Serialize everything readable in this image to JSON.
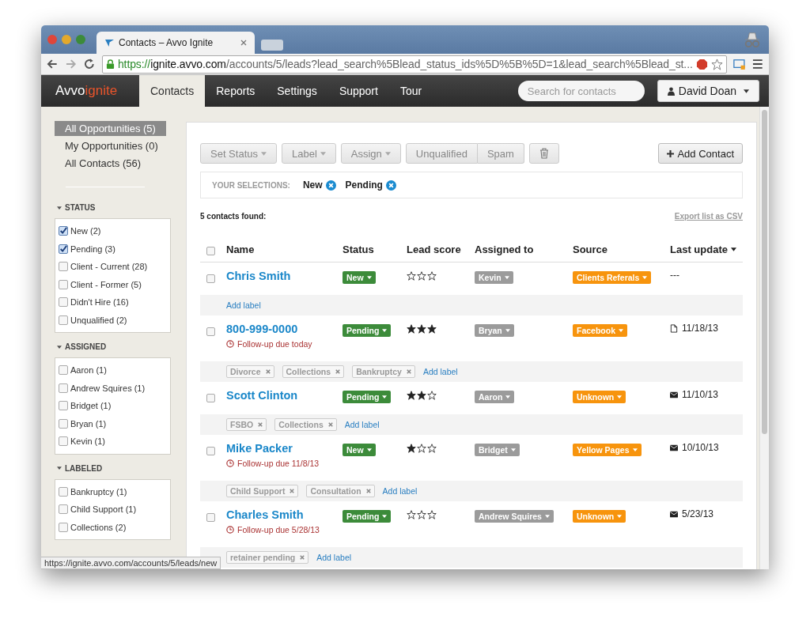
{
  "browser": {
    "tab_title": "Contacts – Avvo Ignite",
    "url_scheme": "https://",
    "url_host": "ignite.avvo.com",
    "url_path": "/accounts/5/leads?lead_search%5Blead_status_ids%5D%5B%5D=1&lead_search%5Blead_st...",
    "status_url": "https://ignite.avvo.com/accounts/5/leads/new"
  },
  "nav": {
    "logo_main": "Avvo",
    "logo_accent": "ignite",
    "items": [
      {
        "label": "Contacts",
        "selected": true
      },
      {
        "label": "Reports",
        "selected": false
      },
      {
        "label": "Settings",
        "selected": false
      },
      {
        "label": "Support",
        "selected": false
      },
      {
        "label": "Tour",
        "selected": false
      }
    ],
    "search_placeholder": "Search for contacts",
    "user": "David Doan"
  },
  "sidebar": {
    "views": [
      {
        "label": "All Opportunities (5)",
        "selected": true
      },
      {
        "label": "My Opportunities (0)",
        "selected": false
      },
      {
        "label": "All Contacts (56)",
        "selected": false
      }
    ],
    "sections": [
      {
        "title": "STATUS",
        "items": [
          {
            "label": "New (2)",
            "checked": true
          },
          {
            "label": "Pending (3)",
            "checked": true
          },
          {
            "label": "Client - Current (28)",
            "checked": false
          },
          {
            "label": "Client - Former (5)",
            "checked": false
          },
          {
            "label": "Didn't Hire (16)",
            "checked": false
          },
          {
            "label": "Unqualified (2)",
            "checked": false
          }
        ]
      },
      {
        "title": "ASSIGNED",
        "items": [
          {
            "label": "Aaron (1)",
            "checked": false
          },
          {
            "label": "Andrew Squires (1)",
            "checked": false
          },
          {
            "label": "Bridget (1)",
            "checked": false
          },
          {
            "label": "Bryan (1)",
            "checked": false
          },
          {
            "label": "Kevin (1)",
            "checked": false
          }
        ]
      },
      {
        "title": "LABELED",
        "items": [
          {
            "label": "Bankruptcy (1)",
            "checked": false
          },
          {
            "label": "Child Support (1)",
            "checked": false
          },
          {
            "label": "Collections (2)",
            "checked": false
          }
        ]
      }
    ]
  },
  "toolbar": {
    "groups": [
      [
        {
          "label": "Set Status",
          "kind": "dropdown"
        }
      ],
      [
        {
          "label": "Label",
          "kind": "dropdown"
        }
      ],
      [
        {
          "label": "Assign",
          "kind": "dropdown"
        }
      ],
      [
        {
          "label": "Unqualified",
          "kind": "plain"
        },
        {
          "label": "Spam",
          "kind": "plain"
        }
      ],
      [
        {
          "kind": "trash"
        }
      ]
    ],
    "add_button": "Add Contact"
  },
  "selections": {
    "label": "YOUR SELECTIONS:",
    "items": [
      "New",
      "Pending"
    ]
  },
  "found": "5 contacts found:",
  "export": "Export list as CSV",
  "select_all": {
    "checked": false
  },
  "columns": [
    "Name",
    "Status",
    "Lead score",
    "Assigned to",
    "Source",
    "Last update"
  ],
  "rows": [
    {
      "checked": false,
      "name": "Chris Smith",
      "status": "New",
      "stars": 0,
      "assigned": "Kevin",
      "source": "Clients Referals",
      "last_update": {
        "date": "---"
      },
      "labels": [
        {
          "kind": "add",
          "text": "Add label"
        }
      ]
    },
    {
      "checked": false,
      "name": "800-999-0000",
      "status": "Pending",
      "stars": 3,
      "assigned": "Bryan",
      "source": "Facebook",
      "last_update": {
        "kind": "document",
        "date": "11/18/13"
      },
      "followup": "Follow-up due today",
      "labels": [
        {
          "kind": "tag",
          "text": "Divorce"
        },
        {
          "kind": "tag",
          "text": "Collections"
        },
        {
          "kind": "tag",
          "text": "Bankruptcy"
        },
        {
          "kind": "add",
          "text": "Add label"
        }
      ]
    },
    {
      "checked": false,
      "name": "Scott Clinton",
      "status": "Pending",
      "stars": 2,
      "assigned": "Aaron",
      "source": "Unknown",
      "last_update": {
        "kind": "mail",
        "date": "11/10/13"
      },
      "labels": [
        {
          "kind": "tag",
          "text": "FSBO"
        },
        {
          "kind": "tag",
          "text": "Collections"
        },
        {
          "kind": "add",
          "text": "Add label"
        }
      ]
    },
    {
      "checked": false,
      "name": "Mike Packer",
      "status": "New",
      "stars": 1,
      "assigned": "Bridget",
      "source": "Yellow Pages",
      "last_update": {
        "kind": "mail",
        "date": "10/10/13"
      },
      "followup": "Follow-up due 11/8/13",
      "labels": [
        {
          "kind": "tag",
          "text": "Child Support"
        },
        {
          "kind": "tag",
          "text": "Consultation"
        },
        {
          "kind": "add",
          "text": "Add label"
        }
      ]
    },
    {
      "checked": false,
      "name": "Charles Smith",
      "status": "Pending",
      "stars": 0,
      "assigned": "Andrew Squires",
      "source": "Unknown",
      "last_update": {
        "kind": "mail",
        "date": "5/23/13"
      },
      "followup": "Follow-up due 5/28/13",
      "labels": [
        {
          "kind": "tag",
          "text": "retainer pending"
        },
        {
          "kind": "add",
          "text": "Add label"
        }
      ]
    }
  ]
}
